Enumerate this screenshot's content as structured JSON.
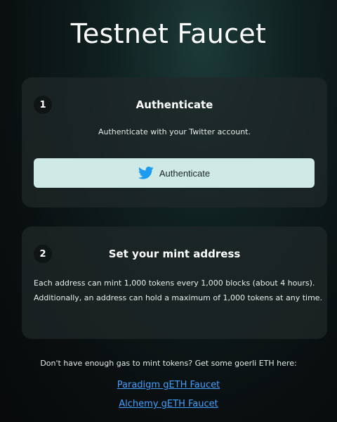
{
  "page": {
    "title": "Testnet Faucet"
  },
  "step1": {
    "number": "1",
    "title": "Authenticate",
    "description": "Authenticate with your Twitter account.",
    "button_label": "Authenticate",
    "button_icon": "twitter-icon",
    "button_bg": "#cfe9e6",
    "icon_color": "#1d9bf0"
  },
  "step2": {
    "number": "2",
    "title": "Set your mint address",
    "body_line1": "Each address can mint 1,000 tokens every 1,000 blocks (about 4 hours).",
    "body_line2": "Additionally, an address can hold a maximum of 1,000 tokens at any time."
  },
  "footer": {
    "note": "Don't have enough gas to mint tokens? Get some goerli ETH here:",
    "links": [
      {
        "label": "Paradigm gETH Faucet"
      },
      {
        "label": "Alchemy gETH Faucet"
      }
    ],
    "link_color": "#3ea1ff"
  }
}
